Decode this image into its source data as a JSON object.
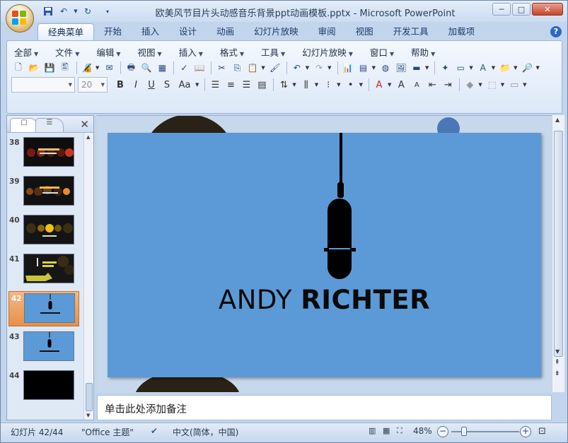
{
  "window": {
    "title": "欧美风节目片头动感音乐背景ppt动画模板.pptx - Microsoft PowerPoint",
    "buttons": {
      "minimize": "─",
      "maximize": "□",
      "close": "✕"
    }
  },
  "tabs": [
    {
      "label": "经典菜单",
      "active": true
    },
    {
      "label": "开始"
    },
    {
      "label": "插入"
    },
    {
      "label": "设计"
    },
    {
      "label": "动画"
    },
    {
      "label": "幻灯片放映"
    },
    {
      "label": "审阅"
    },
    {
      "label": "视图"
    },
    {
      "label": "开发工具"
    },
    {
      "label": "加载项"
    }
  ],
  "classic_menu": [
    "全部",
    "文件",
    "编辑",
    "视图",
    "插入",
    "格式",
    "工具",
    "幻灯片放映",
    "窗口",
    "帮助"
  ],
  "format_toolbar": {
    "font_name": "",
    "font_size": "20",
    "buttons": [
      "B",
      "I",
      "U",
      "S",
      "Aa"
    ]
  },
  "slide_panel": {
    "thumbnails": [
      {
        "number": "38",
        "selected": false
      },
      {
        "number": "39",
        "selected": false
      },
      {
        "number": "40",
        "selected": false
      },
      {
        "number": "41",
        "selected": false
      },
      {
        "number": "42",
        "selected": true
      },
      {
        "number": "43",
        "selected": false
      },
      {
        "number": "44",
        "selected": false
      }
    ]
  },
  "slide": {
    "title_light": "ANDY",
    "title_bold": "RICHTER",
    "background_color": "#5b9ad6"
  },
  "notes": {
    "placeholder": "单击此处添加备注"
  },
  "status_bar": {
    "slide_indicator": "幻灯片 42/44",
    "theme": "\"Office 主题\"",
    "language": "中文(简体，中国)",
    "zoom": "48%"
  },
  "colors": {
    "accent": "#2c69c4",
    "selected_thumb": "#e4914c"
  }
}
